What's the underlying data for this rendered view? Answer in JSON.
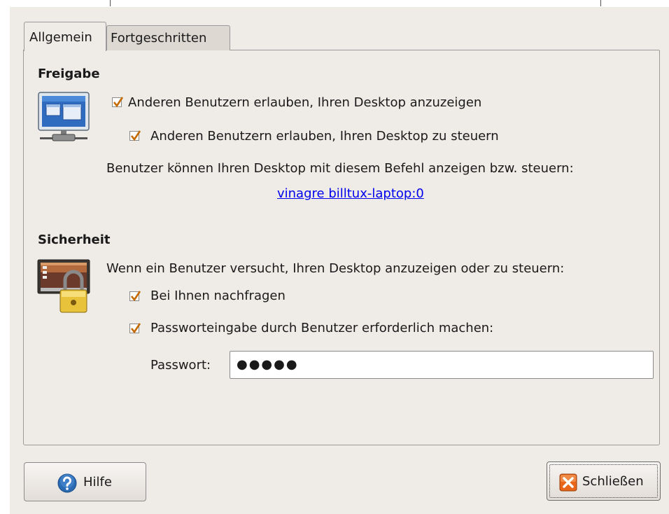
{
  "tabs": [
    {
      "label": "Allgemein",
      "active": true
    },
    {
      "label": "Fortgeschritten",
      "active": false
    }
  ],
  "sharing": {
    "heading": "Freigabe",
    "allow_view": {
      "label": "Anderen Benutzern erlauben, Ihren Desktop anzuzeigen",
      "checked": true
    },
    "allow_control": {
      "label": "Anderen Benutzern erlauben, Ihren Desktop zu steuern",
      "checked": true
    },
    "command_hint": "Benutzer können Ihren Desktop mit diesem Befehl anzeigen bzw. steuern:",
    "command_link": "vinagre billtux-laptop:0"
  },
  "security": {
    "heading": "Sicherheit",
    "intro": "Wenn ein Benutzer versucht, Ihren Desktop anzuzeigen oder zu steuern:",
    "ask": {
      "label": "Bei Ihnen nachfragen",
      "checked": true
    },
    "require_password": {
      "label": "Passworteingabe durch Benutzer erforderlich machen:",
      "checked": true
    },
    "password_label": "Passwort:",
    "password_value": "●●●●●"
  },
  "buttons": {
    "help_label": "Hilfe",
    "close_label": "Schließen"
  },
  "colors": {
    "window_bg": "#efebe7",
    "link": "#0000ee",
    "checkmark": "#c46a00",
    "help_icon": "#2a6ab3",
    "close_icon": "#e8651a"
  },
  "icons": {
    "sharing": "monitor-network-icon",
    "security": "screen-lock-icon",
    "help": "help-icon",
    "close": "close-icon"
  }
}
